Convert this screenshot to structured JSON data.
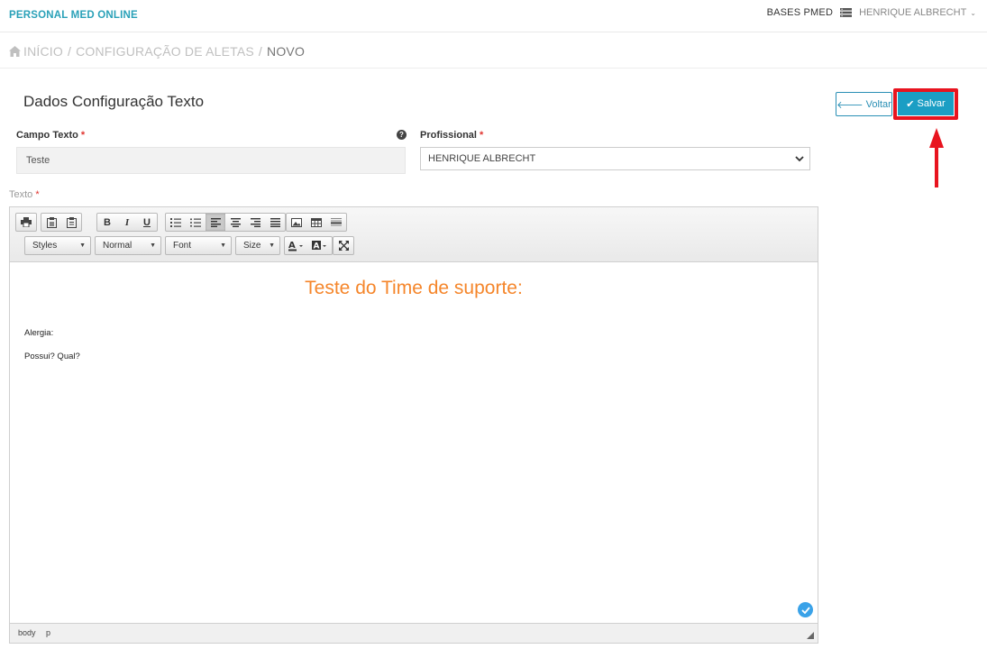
{
  "header": {
    "brand": "PERSONAL MED ONLINE",
    "bases_label": "BASES PMED",
    "user_name": "HENRIQUE ALBRECHT"
  },
  "breadcrumb": {
    "home": "INÍCIO",
    "sep1": "/",
    "section": "CONFIGURAÇÃO DE ALETAS",
    "sep2": "/",
    "current": "NOVO"
  },
  "page": {
    "title": "Dados Configuração Texto"
  },
  "actions": {
    "back_label": "Voltar",
    "save_label": "Salvar"
  },
  "form": {
    "campo_texto": {
      "label": "Campo Texto",
      "required": "*",
      "value": "Teste"
    },
    "profissional": {
      "label": "Profissional",
      "required": "*",
      "selected": "HENRIQUE ALBRECHT"
    },
    "texto": {
      "label": "Texto",
      "required": "*"
    }
  },
  "editor": {
    "toolbar": {
      "styles": "Styles",
      "format": "Normal",
      "font": "Font",
      "size": "Size"
    },
    "content": {
      "heading": "Teste do Time de suporte:",
      "line1": "Alergia:",
      "line2": "Possui? Qual?",
      "heading_color": "#f5862b"
    },
    "status_path": [
      "body",
      "p"
    ]
  },
  "colors": {
    "brand": "#2aa1b8",
    "primary": "#1b9ec4",
    "highlight": "#e8141f",
    "required": "#e0342f"
  }
}
